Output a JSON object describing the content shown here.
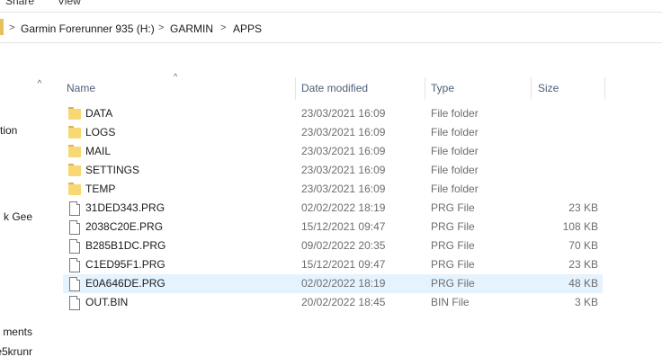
{
  "ribbon": {
    "tabs": [
      "Share",
      "View"
    ]
  },
  "address": {
    "crumbs": [
      "Garmin Forerunner 935 (H:)",
      "GARMIN",
      "APPS"
    ],
    "separator": ">"
  },
  "nav": {
    "fragments": [
      "tion",
      "k Gee",
      "ments",
      "e5krunr"
    ],
    "scroll_up": "^"
  },
  "columns": {
    "sort_indicator": "^",
    "name": "Name",
    "date": "Date modified",
    "type": "Type",
    "size": "Size"
  },
  "files": [
    {
      "name": "DATA",
      "date": "23/03/2021 16:09",
      "type": "File folder",
      "size": "",
      "icon": "folder-icon"
    },
    {
      "name": "LOGS",
      "date": "23/03/2021 16:09",
      "type": "File folder",
      "size": "",
      "icon": "folder-icon"
    },
    {
      "name": "MAIL",
      "date": "23/03/2021 16:09",
      "type": "File folder",
      "size": "",
      "icon": "folder-icon"
    },
    {
      "name": "SETTINGS",
      "date": "23/03/2021 16:09",
      "type": "File folder",
      "size": "",
      "icon": "folder-icon"
    },
    {
      "name": "TEMP",
      "date": "23/03/2021 16:09",
      "type": "File folder",
      "size": "",
      "icon": "folder-icon"
    },
    {
      "name": "31DED343.PRG",
      "date": "02/02/2022 18:19",
      "type": "PRG File",
      "size": "23 KB",
      "icon": "file-icon"
    },
    {
      "name": "2038C20E.PRG",
      "date": "15/12/2021 09:47",
      "type": "PRG File",
      "size": "108 KB",
      "icon": "file-icon"
    },
    {
      "name": "B285B1DC.PRG",
      "date": "09/02/2022 20:35",
      "type": "PRG File",
      "size": "70 KB",
      "icon": "file-icon"
    },
    {
      "name": "C1ED95F1.PRG",
      "date": "15/12/2021 09:47",
      "type": "PRG File",
      "size": "23 KB",
      "icon": "file-icon"
    },
    {
      "name": "E0A646DE.PRG",
      "date": "02/02/2022 18:19",
      "type": "PRG File",
      "size": "48 KB",
      "icon": "file-icon",
      "selected": true
    },
    {
      "name": "OUT.BIN",
      "date": "20/02/2022 18:45",
      "type": "BIN File",
      "size": "3 KB",
      "icon": "file-icon"
    }
  ]
}
